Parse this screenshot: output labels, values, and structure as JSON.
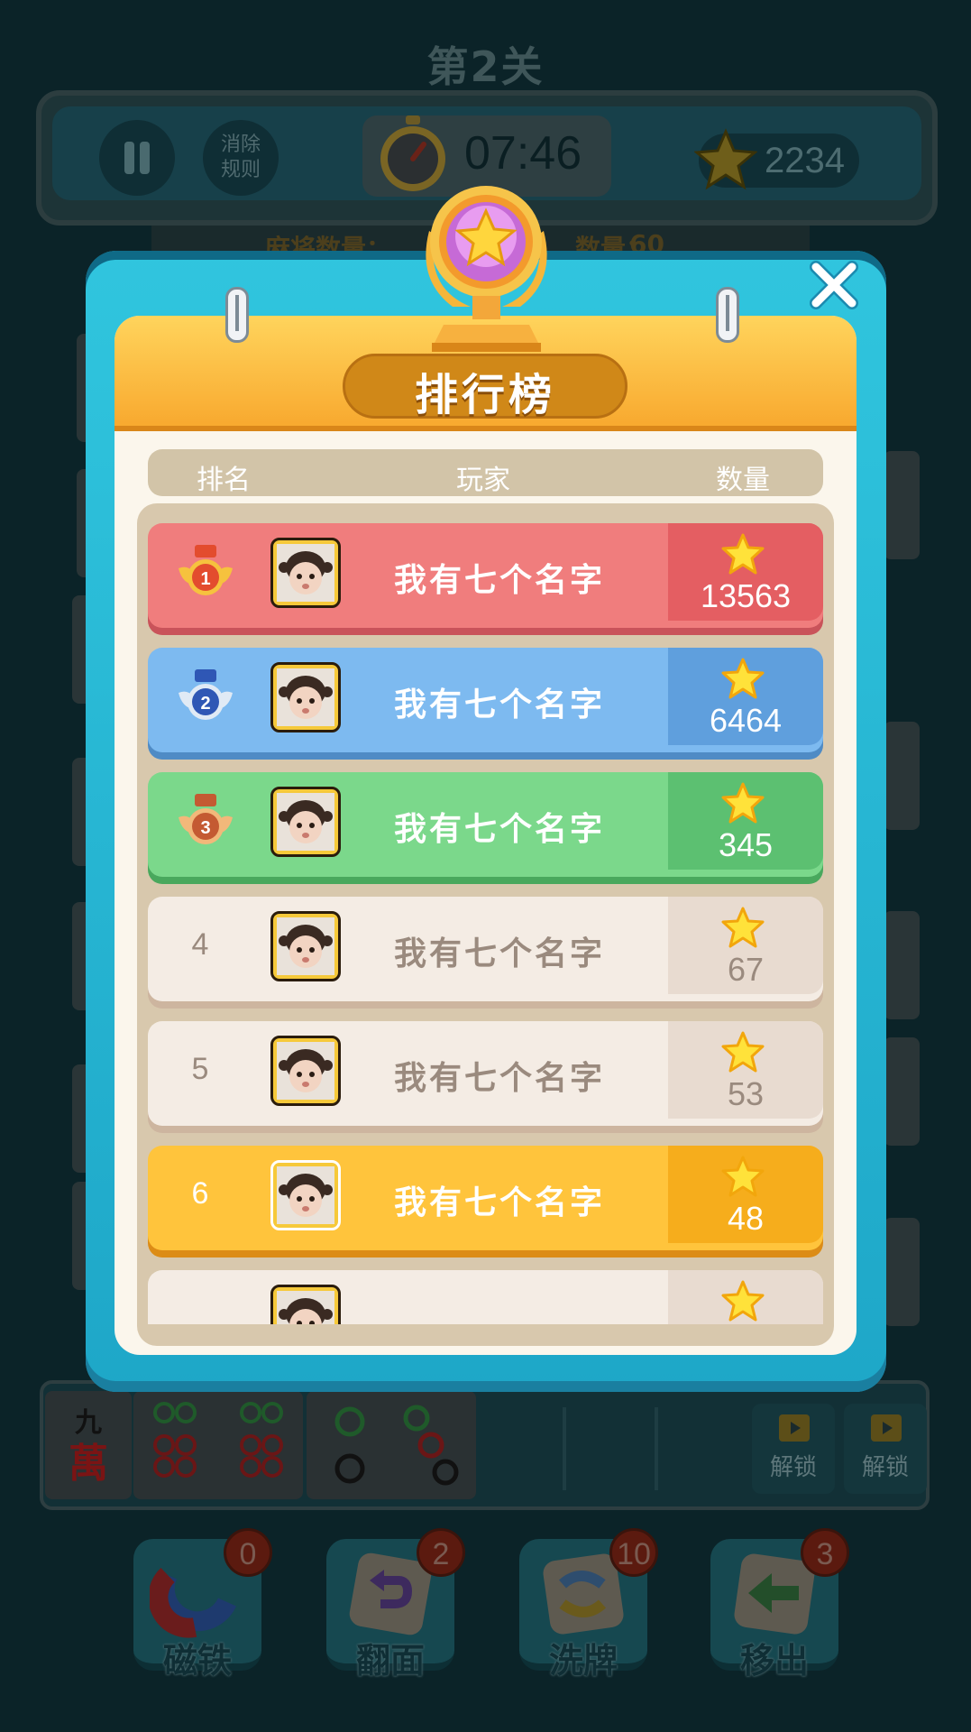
{
  "level": {
    "title": "第2关"
  },
  "top_bar": {
    "rules_label": "消除规则",
    "timer": "07:46",
    "score": "2234",
    "faded_left": "麻将数量：",
    "faded_right": "数量：",
    "faded_right_value": "60"
  },
  "leaderboard": {
    "title": "排行榜",
    "columns": {
      "rank": "排名",
      "player": "玩家",
      "count": "数量"
    },
    "rows": [
      {
        "rank": "1",
        "name": "我有七个名字",
        "score": "13563",
        "style": "gold-medal"
      },
      {
        "rank": "2",
        "name": "我有七个名字",
        "score": "6464",
        "style": "silver-medal"
      },
      {
        "rank": "3",
        "name": "我有七个名字",
        "score": "345",
        "style": "bronze-medal"
      },
      {
        "rank": "4",
        "name": "我有七个名字",
        "score": "67",
        "style": "plain"
      },
      {
        "rank": "5",
        "name": "我有七个名字",
        "score": "53",
        "style": "plain"
      },
      {
        "rank": "6",
        "name": "我有七个名字",
        "score": "48",
        "style": "self"
      },
      {
        "rank": "",
        "name": "",
        "score": "",
        "style": "plain"
      }
    ]
  },
  "tray": {
    "tile1_chars": [
      "九",
      "萬"
    ],
    "unlock_label": "解锁"
  },
  "powerups": [
    {
      "label": "磁铁",
      "count": "0",
      "icon": "magnet-icon"
    },
    {
      "label": "翻面",
      "count": "2",
      "icon": "flip-icon"
    },
    {
      "label": "洗牌",
      "count": "10",
      "icon": "shuffle-icon"
    },
    {
      "label": "移出",
      "count": "3",
      "icon": "move-out-icon"
    }
  ],
  "colors": {
    "row1": "#f07d7d",
    "row1_score": "#e45e62",
    "row2": "#7dbaf0",
    "row2_score": "#5f9fdd",
    "row3": "#7bd88b",
    "row3_score": "#5cc071",
    "plain": "#f4ece4",
    "plain_score": "#e8dbd0",
    "self": "#ffc43c",
    "self_score": "#f6ad1c"
  }
}
